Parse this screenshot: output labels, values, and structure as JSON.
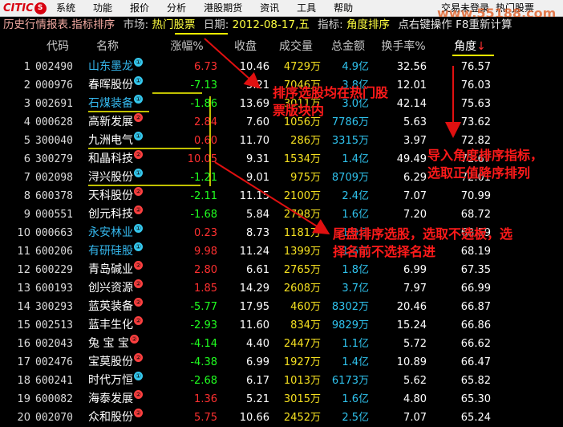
{
  "menubar": {
    "logo": "CITIC",
    "logo_mark": "S",
    "items": [
      "系统",
      "功能",
      "报价",
      "分析",
      "港股期货",
      "资讯",
      "工具",
      "帮助"
    ],
    "status": "交易未登录",
    "hot": "热门股票"
  },
  "watermark": "www.55188.com",
  "infobar": {
    "title": "历史行情报表.指标排序",
    "market_label": "市场:",
    "market_value": "热门股票",
    "date_label": "日期:",
    "date_value": "2012-08-17,五",
    "indicator_label": "指标:",
    "indicator_value": "角度排序",
    "hint": "点右键操作 F8重新计算"
  },
  "columns": {
    "code": "代码",
    "name": "名称",
    "change": "涨幅%",
    "price": "收盘",
    "volume": "成交量",
    "amount": "总金额",
    "turnover": "换手率%",
    "angle": "角度",
    "sort_arrow": "↓"
  },
  "colors": {
    "up": "#ff3030",
    "down": "#20ff20",
    "flat": "#dcdcdc",
    "name_blue": "#35b8ee",
    "name_white": "#ffffff",
    "badge_1": "#35c8ee",
    "badge_2": "#ff4040",
    "annotation": "#ff1a1a",
    "underline": "#ffff00"
  },
  "rows": [
    {
      "idx": "1",
      "code": "002490",
      "name": "山东墨龙",
      "badge": "①",
      "badge_type": 1,
      "name_color": "blue",
      "change": "6.73",
      "dir": "up",
      "price": "10.46",
      "volume": "4729万",
      "amount": "4.9亿",
      "turnover": "32.56",
      "angle": "76.57"
    },
    {
      "idx": "2",
      "code": "000976",
      "name": "春晖股份",
      "badge": "①",
      "badge_type": 1,
      "name_color": "white",
      "change": "-7.13",
      "dir": "down",
      "price": "5.21",
      "volume": "7046万",
      "amount": "3.8亿",
      "turnover": "12.01",
      "angle": "76.03"
    },
    {
      "idx": "3",
      "code": "002691",
      "name": "石煤装备",
      "badge": "①",
      "badge_type": 1,
      "name_color": "blue",
      "change": "-1.86",
      "dir": "down",
      "price": "13.69",
      "volume": "3011万",
      "amount": "3.0亿",
      "turnover": "42.14",
      "angle": "75.63"
    },
    {
      "idx": "4",
      "code": "000628",
      "name": "高新发展",
      "badge": "②",
      "badge_type": 2,
      "name_color": "white",
      "change": "2.84",
      "dir": "up",
      "price": "7.60",
      "volume": "1056万",
      "amount": "7786万",
      "turnover": "5.63",
      "angle": "73.62"
    },
    {
      "idx": "5",
      "code": "300040",
      "name": "九洲电气",
      "badge": "①",
      "badge_type": 1,
      "name_color": "white",
      "change": "0.60",
      "dir": "up",
      "price": "11.70",
      "volume": "286万",
      "amount": "3315万",
      "turnover": "3.97",
      "angle": "72.82"
    },
    {
      "idx": "6",
      "code": "300279",
      "name": "和晶科技",
      "badge": "②",
      "badge_type": 2,
      "name_color": "white",
      "change": "10.05",
      "dir": "up",
      "price": "9.31",
      "volume": "1534万",
      "amount": "1.4亿",
      "turnover": "49.49",
      "angle": "72.67"
    },
    {
      "idx": "7",
      "code": "002098",
      "name": "浔兴股份",
      "badge": "①",
      "badge_type": 1,
      "name_color": "white",
      "change": "-1.21",
      "dir": "down",
      "price": "9.01",
      "volume": "975万",
      "amount": "8709万",
      "turnover": "6.29",
      "angle": "72.01"
    },
    {
      "idx": "8",
      "code": "600378",
      "name": "天科股份",
      "badge": "②",
      "badge_type": 2,
      "name_color": "white",
      "change": "-2.11",
      "dir": "down",
      "price": "11.15",
      "volume": "2100万",
      "amount": "2.4亿",
      "turnover": "7.07",
      "angle": "70.99"
    },
    {
      "idx": "9",
      "code": "000551",
      "name": "创元科技",
      "badge": "②",
      "badge_type": 2,
      "name_color": "white",
      "change": "-1.68",
      "dir": "down",
      "price": "5.84",
      "volume": "2798万",
      "amount": "1.6亿",
      "turnover": "7.20",
      "angle": "68.72"
    },
    {
      "idx": "10",
      "code": "000663",
      "name": "永安林业",
      "badge": "①",
      "badge_type": 1,
      "name_color": "blue",
      "change": "0.23",
      "dir": "up",
      "price": "8.73",
      "volume": "1181万",
      "amount": "1.0亿",
      "turnover": "",
      "angle": "68.59"
    },
    {
      "idx": "11",
      "code": "600206",
      "name": "有研硅股",
      "badge": "①",
      "badge_type": 1,
      "name_color": "blue",
      "change": "9.98",
      "dir": "up",
      "price": "11.24",
      "volume": "1399万",
      "amount": "1.6亿",
      "turnover": "",
      "angle": "68.19"
    },
    {
      "idx": "12",
      "code": "600229",
      "name": "青岛碱业",
      "badge": "②",
      "badge_type": 2,
      "name_color": "white",
      "change": "2.80",
      "dir": "up",
      "price": "6.61",
      "volume": "2765万",
      "amount": "1.8亿",
      "turnover": "6.99",
      "angle": "67.35"
    },
    {
      "idx": "13",
      "code": "600193",
      "name": "创兴资源",
      "badge": "②",
      "badge_type": 2,
      "name_color": "white",
      "change": "1.85",
      "dir": "up",
      "price": "14.29",
      "volume": "2608万",
      "amount": "3.7亿",
      "turnover": "7.97",
      "angle": "66.99"
    },
    {
      "idx": "14",
      "code": "300293",
      "name": "蓝英装备",
      "badge": "②",
      "badge_type": 2,
      "name_color": "white",
      "change": "-5.77",
      "dir": "down",
      "price": "17.95",
      "volume": "460万",
      "amount": "8302万",
      "turnover": "20.46",
      "angle": "66.87"
    },
    {
      "idx": "15",
      "code": "002513",
      "name": "蓝丰生化",
      "badge": "②",
      "badge_type": 2,
      "name_color": "white",
      "change": "-2.93",
      "dir": "down",
      "price": "11.60",
      "volume": "834万",
      "amount": "9829万",
      "turnover": "15.24",
      "angle": "66.86"
    },
    {
      "idx": "16",
      "code": "002043",
      "name": "兔 宝 宝",
      "badge": "②",
      "badge_type": 2,
      "name_color": "white",
      "change": "-4.14",
      "dir": "down",
      "price": "4.40",
      "volume": "2447万",
      "amount": "1.1亿",
      "turnover": "5.72",
      "angle": "66.62"
    },
    {
      "idx": "17",
      "code": "002476",
      "name": "宝莫股份",
      "badge": "②",
      "badge_type": 2,
      "name_color": "white",
      "change": "-4.38",
      "dir": "down",
      "price": "6.99",
      "volume": "1927万",
      "amount": "1.4亿",
      "turnover": "10.89",
      "angle": "66.47"
    },
    {
      "idx": "18",
      "code": "600241",
      "name": "时代万恒",
      "badge": "①",
      "badge_type": 1,
      "name_color": "white",
      "change": "-2.68",
      "dir": "down",
      "price": "6.17",
      "volume": "1013万",
      "amount": "6173万",
      "turnover": "5.62",
      "angle": "65.82"
    },
    {
      "idx": "19",
      "code": "600082",
      "name": "海泰发展",
      "badge": "②",
      "badge_type": 2,
      "name_color": "white",
      "change": "1.36",
      "dir": "up",
      "price": "5.21",
      "volume": "3015万",
      "amount": "1.6亿",
      "turnover": "4.80",
      "angle": "65.30"
    },
    {
      "idx": "20",
      "code": "002070",
      "name": "众和股份",
      "badge": "②",
      "badge_type": 2,
      "name_color": "white",
      "change": "5.75",
      "dir": "up",
      "price": "10.66",
      "volume": "2452万",
      "amount": "2.5亿",
      "turnover": "7.07",
      "angle": "65.24"
    }
  ],
  "annotations": {
    "note1": "排序选股均在热门股票版块内",
    "note2": "导入角度排序指标，选取正值降序排列",
    "note3": "尾盘排序选股，选取不选板，选择名前不选择名进"
  }
}
